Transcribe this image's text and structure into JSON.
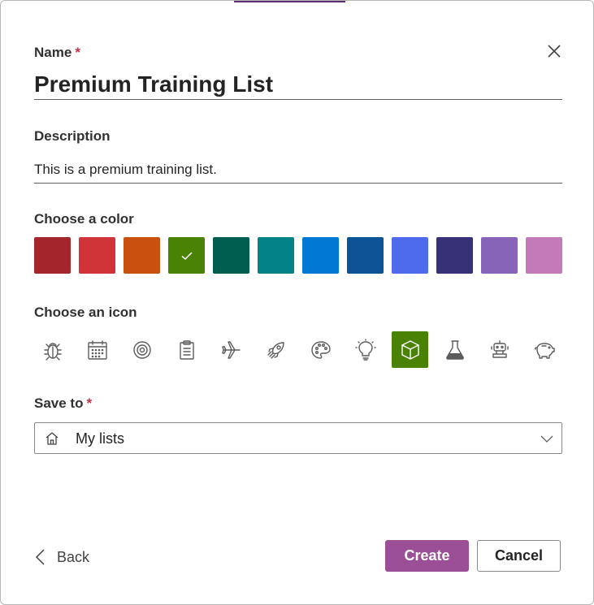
{
  "name": {
    "label": "Name",
    "required_mark": "*",
    "value": "Premium Training List"
  },
  "description": {
    "label": "Description",
    "value": "This is a premium training list."
  },
  "color": {
    "label": "Choose a color",
    "swatches": [
      "#a4262c",
      "#d13438",
      "#ca5010",
      "#498205",
      "#005e50",
      "#038387",
      "#0078d4",
      "#0b5394",
      "#4f6bed",
      "#373277",
      "#8764b8",
      "#c27ab9"
    ],
    "selected_index": 3
  },
  "icon": {
    "label": "Choose an icon",
    "items": [
      "bug-icon",
      "calendar-icon",
      "target-icon",
      "clipboard-icon",
      "airplane-icon",
      "rocket-icon",
      "palette-icon",
      "lightbulb-icon",
      "box-icon",
      "flask-icon",
      "robot-icon",
      "piggy-bank-icon"
    ],
    "selected_index": 8
  },
  "save_to": {
    "label": "Save to",
    "required_mark": "*",
    "value": "My lists"
  },
  "footer": {
    "back_label": "Back",
    "create_label": "Create",
    "cancel_label": "Cancel"
  }
}
